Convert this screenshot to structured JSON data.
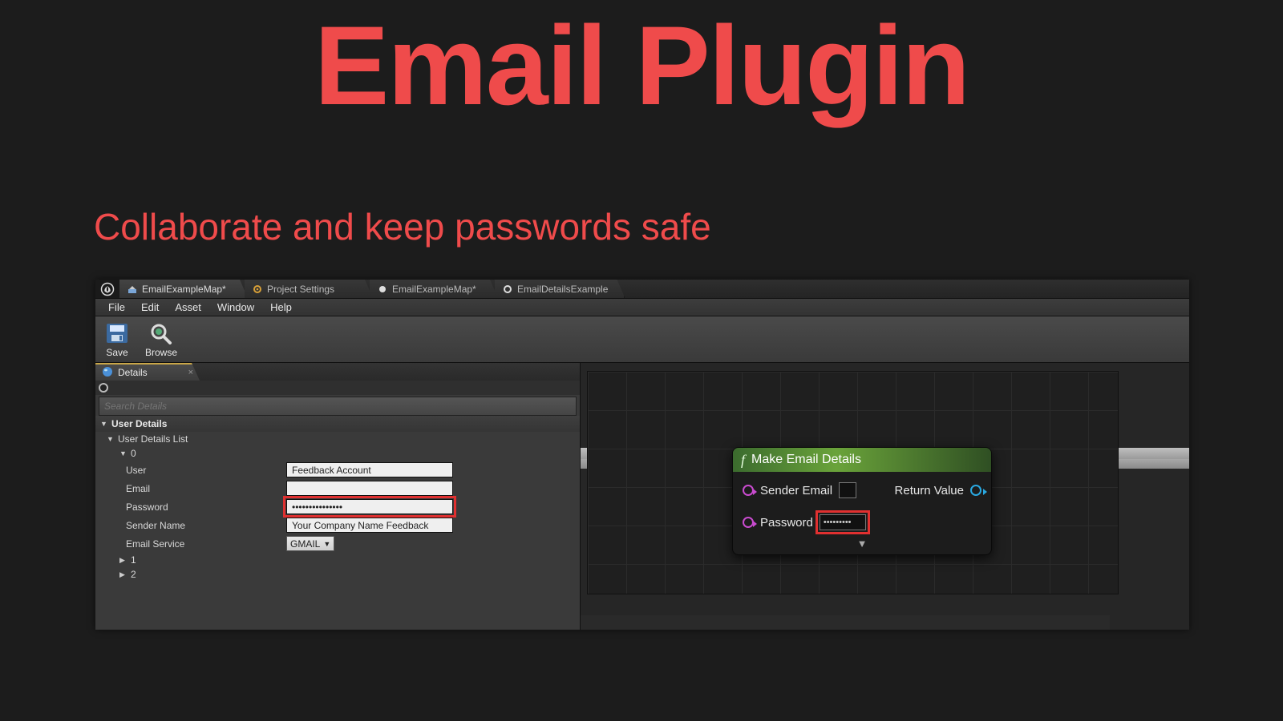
{
  "slide": {
    "title": "Email Plugin",
    "subtitle": "Collaborate and keep passwords safe"
  },
  "tabs": [
    {
      "label": "EmailExampleMap*",
      "icon": "level"
    },
    {
      "label": "Project Settings",
      "icon": "gear"
    },
    {
      "label": "EmailExampleMap*",
      "icon": "dot"
    },
    {
      "label": "EmailDetailsExample",
      "icon": "ring"
    }
  ],
  "menu": [
    "File",
    "Edit",
    "Asset",
    "Window",
    "Help"
  ],
  "toolbar": {
    "save": "Save",
    "browse": "Browse"
  },
  "details": {
    "tab_label": "Details",
    "search_placeholder": "Search Details",
    "section": "User Details",
    "list_label": "User Details List",
    "rows": [
      "0",
      "1",
      "2"
    ],
    "fields": {
      "user_label": "User",
      "user_value": "Feedback Account",
      "email_label": "Email",
      "email_value": "",
      "password_label": "Password",
      "password_value": "•••••••••••••••",
      "sender_label": "Sender Name",
      "sender_value": "Your Company Name Feedback",
      "service_label": "Email Service",
      "service_value": "GMAIL"
    }
  },
  "node": {
    "title": "Make Email Details",
    "sender_email": "Sender Email",
    "password": "Password",
    "password_value": "•••••••••",
    "return_value": "Return Value",
    "expand": "▼"
  }
}
